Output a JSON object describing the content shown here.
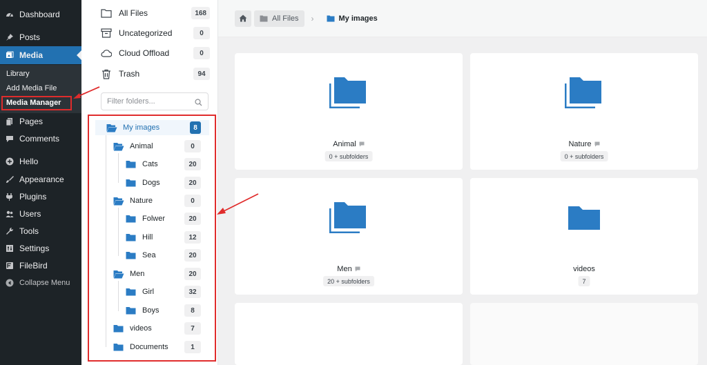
{
  "wp_menu": {
    "items": [
      {
        "label": "Dashboard",
        "icon": "dashboard-icon"
      },
      {
        "label": "Posts",
        "icon": "pin-icon"
      },
      {
        "label": "Media",
        "icon": "media-icon",
        "active": true
      },
      {
        "label": "Pages",
        "icon": "pages-icon"
      },
      {
        "label": "Comments",
        "icon": "comments-icon"
      },
      {
        "label": "Hello",
        "icon": "plus-circle-icon"
      },
      {
        "label": "Appearance",
        "icon": "brush-icon"
      },
      {
        "label": "Plugins",
        "icon": "plug-icon"
      },
      {
        "label": "Users",
        "icon": "users-icon"
      },
      {
        "label": "Tools",
        "icon": "wrench-icon"
      },
      {
        "label": "Settings",
        "icon": "settings-icon"
      },
      {
        "label": "FileBird",
        "icon": "filebird-icon"
      },
      {
        "label": "Collapse Menu",
        "icon": "collapse-icon"
      }
    ],
    "media_submenu": [
      "Library",
      "Add Media File",
      "Media Manager"
    ]
  },
  "folders": {
    "top": [
      {
        "label": "All Files",
        "count": "168",
        "icon": "folder-outline-icon"
      },
      {
        "label": "Uncategorized",
        "count": "0",
        "icon": "archive-icon"
      },
      {
        "label": "Cloud Offload",
        "count": "0",
        "icon": "cloud-icon"
      },
      {
        "label": "Trash",
        "count": "94",
        "icon": "trash-icon"
      }
    ],
    "filter_placeholder": "Filter folders...",
    "tree": {
      "root": {
        "label": "My images",
        "count": "8"
      },
      "children": [
        {
          "label": "Animal",
          "count": "0"
        },
        {
          "label": "Cats",
          "count": "20"
        },
        {
          "label": "Dogs",
          "count": "20"
        },
        {
          "label": "Nature",
          "count": "0"
        },
        {
          "label": "Folwer",
          "count": "20"
        },
        {
          "label": "Hill",
          "count": "12"
        },
        {
          "label": "Sea",
          "count": "20"
        },
        {
          "label": "Men",
          "count": "20"
        },
        {
          "label": "Girl",
          "count": "32"
        },
        {
          "label": "Boys",
          "count": "8"
        },
        {
          "label": "videos",
          "count": "7"
        },
        {
          "label": "Documents",
          "count": "1"
        }
      ]
    }
  },
  "breadcrumb": {
    "all": "All Files",
    "current": "My images"
  },
  "cards": [
    {
      "name": "Animal",
      "sub": "0 + subfolders"
    },
    {
      "name": "Nature",
      "sub": "0 + subfolders"
    },
    {
      "name": "Men",
      "sub": "20 + subfolders"
    },
    {
      "name": "videos",
      "sub": "7"
    }
  ],
  "colors": {
    "accent": "#2271b1",
    "folder": "#2b7cc4",
    "highlight": "#e02c2c",
    "sidebar": "#1d2327"
  }
}
